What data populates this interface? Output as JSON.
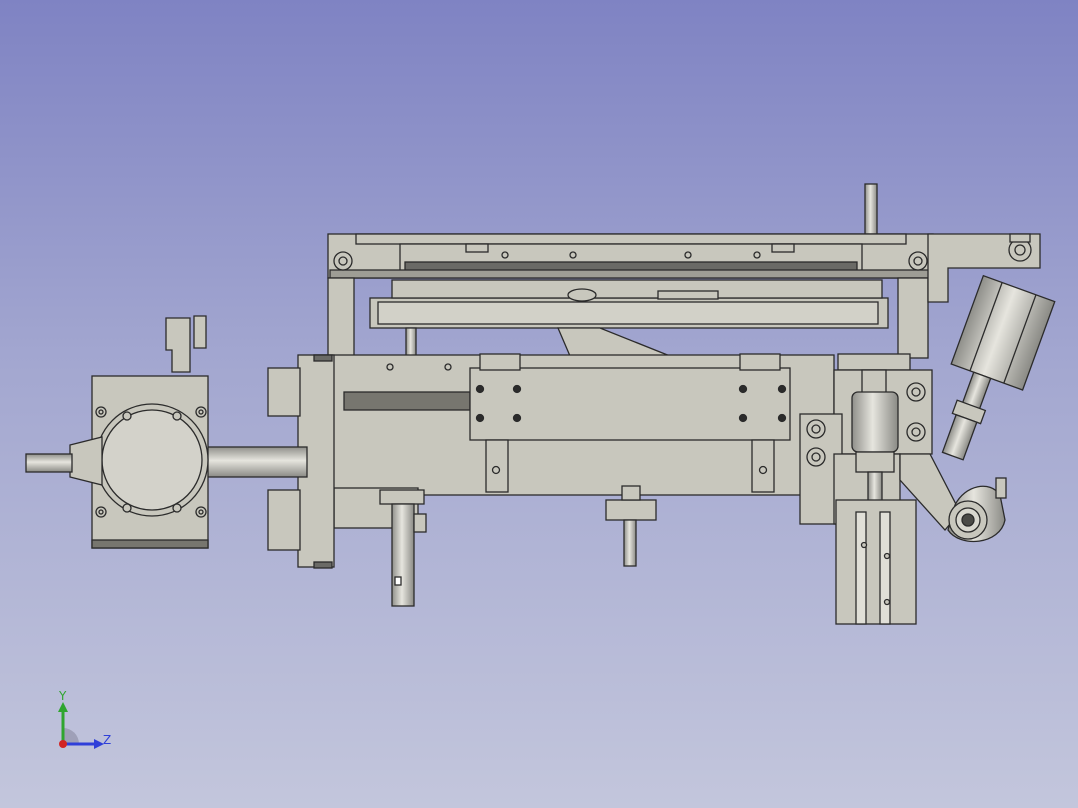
{
  "viewport": {
    "background_top": "#7f83c3",
    "background_bottom": "#c3c6dc",
    "part_fill": "#c8c7bd",
    "part_stroke": "#2b2b2b",
    "shadow_fill": "#8a8a88"
  },
  "axis": {
    "y_label": "Y",
    "z_label": "Z",
    "y_color": "#2fa52f",
    "z_color": "#2f3fd9",
    "x_color": "#d22424"
  },
  "icons": [
    "axis-triad-icon"
  ]
}
